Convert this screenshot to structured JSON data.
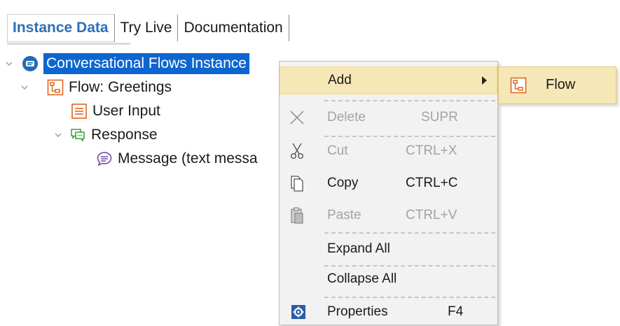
{
  "tabs": [
    {
      "label": "Instance Data",
      "active": true
    },
    {
      "label": "Try Live",
      "active": false
    },
    {
      "label": "Documentation",
      "active": false
    }
  ],
  "tree": {
    "root": {
      "label": "Conversational Flows Instance",
      "icon": "chatbot-instance-icon",
      "selected": true
    },
    "flow": {
      "label": "Flow: Greetings",
      "icon": "flow-icon"
    },
    "user_input": {
      "label": "User Input",
      "icon": "user-input-icon"
    },
    "response": {
      "label": "Response",
      "icon": "response-icon"
    },
    "message": {
      "label": "Message (text messa",
      "icon": "message-icon"
    }
  },
  "context_menu": {
    "add": {
      "label": "Add"
    },
    "delete": {
      "label": "Delete",
      "shortcut": "SUPR",
      "enabled": false
    },
    "cut": {
      "label": "Cut",
      "shortcut": "CTRL+X",
      "enabled": false
    },
    "copy": {
      "label": "Copy",
      "shortcut": "CTRL+C",
      "enabled": true
    },
    "paste": {
      "label": "Paste",
      "shortcut": "CTRL+V",
      "enabled": false
    },
    "expand_all": {
      "label": "Expand All"
    },
    "collapse_all": {
      "label": "Collapse All"
    },
    "properties": {
      "label": "Properties",
      "shortcut": "F4"
    }
  },
  "submenu": {
    "flow": {
      "label": "Flow",
      "icon": "flow-icon"
    }
  },
  "colors": {
    "accent_blue": "#0d66d0",
    "tab_active": "#2e6fb8",
    "menu_hover": "#f6e7b6",
    "flow_orange": "#e0661c",
    "response_green": "#3a9a3a",
    "message_purple": "#6b3fa0"
  }
}
